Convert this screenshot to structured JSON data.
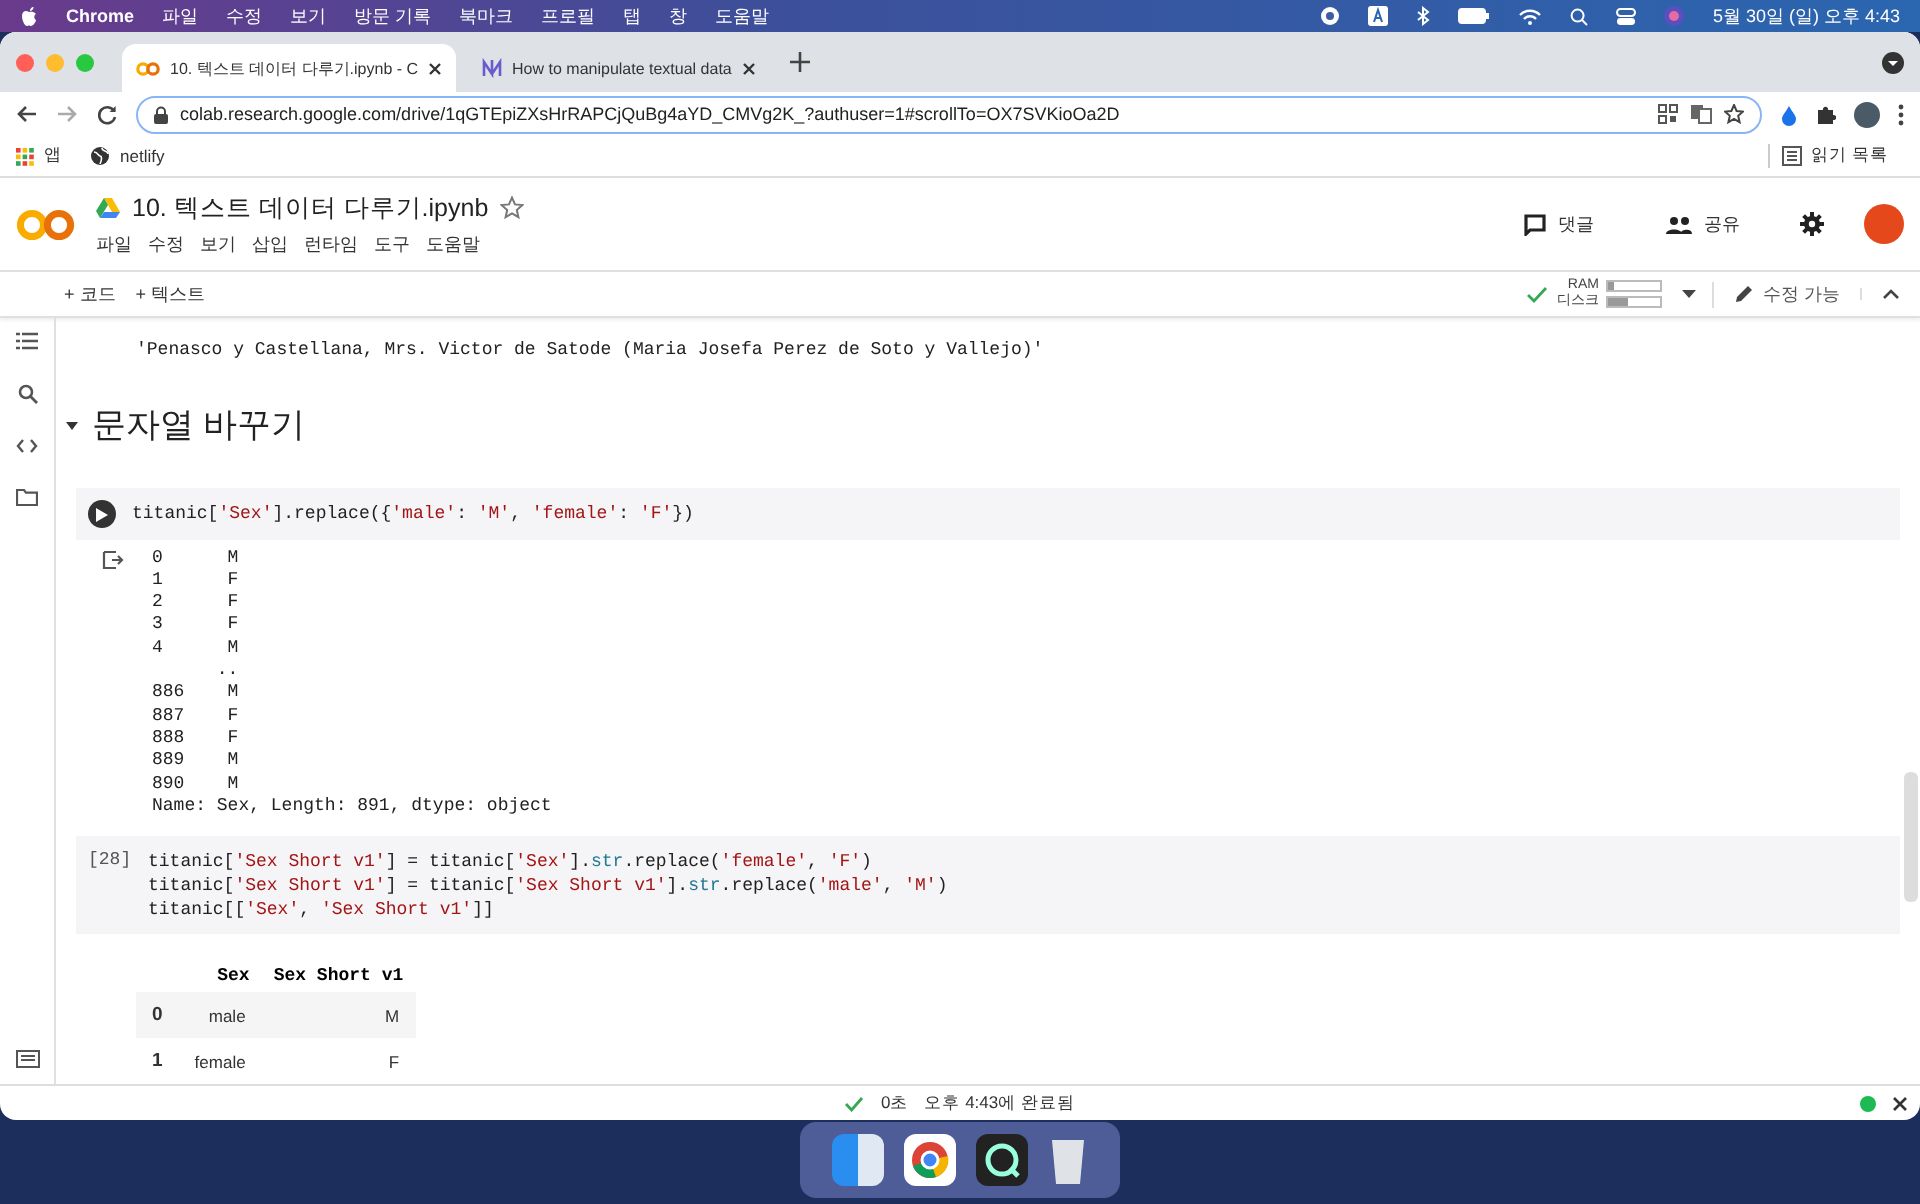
{
  "menubar": {
    "app": "Chrome",
    "menus": [
      "파일",
      "수정",
      "보기",
      "방문 기록",
      "북마크",
      "프로필",
      "탭",
      "창",
      "도움말"
    ],
    "clock": "5월 30일 (일) 오후 4:43"
  },
  "tabs": [
    {
      "title": "10. 텍스트 데이터 다루기.ipynb - C",
      "selected": true
    },
    {
      "title": "How to manipulate textual data",
      "selected": false
    }
  ],
  "address": {
    "url": "colab.research.google.com/drive/1qGTEpiZXsHrRAPCjQuBg4aYD_CMVg2K_?authuser=1#scrollTo=OX7SVKioOa2D"
  },
  "bookmarks": [
    {
      "kind": "apps",
      "label": "앱"
    },
    {
      "kind": "site",
      "label": "netlify"
    }
  ],
  "reading_list": "읽기 목록",
  "notebook": {
    "title": "10. 텍스트 데이터 다루기.ipynb",
    "menus": [
      "파일",
      "수정",
      "보기",
      "삽입",
      "런타임",
      "도구",
      "도움말"
    ],
    "comment": "댓글",
    "share": "공유"
  },
  "toolbar": {
    "add_code": "+ 코드",
    "add_text": "+ 텍스트",
    "resources": [
      {
        "label": "RAM",
        "level": 0.08
      },
      {
        "label": "디스크",
        "level": 0.38
      }
    ],
    "edit_mode": "수정 가능"
  },
  "cells": [
    {
      "kind": "output",
      "lines": [
        "'Penasco y Castellana, Mrs. Victor de Satode (Maria Josefa Perez de Soto y Vallejo)'"
      ]
    },
    {
      "kind": "heading",
      "text": "문자열 바꾸기",
      "expanded": true
    },
    {
      "kind": "code",
      "lines": [
        [
          {
            "kind": "plain",
            "text": "titanic["
          },
          {
            "kind": "string",
            "text": "'Sex'"
          },
          {
            "kind": "plain",
            "text": "].replace({"
          },
          {
            "kind": "string",
            "text": "'male'"
          },
          {
            "kind": "plain",
            "text": ": "
          },
          {
            "kind": "string",
            "text": "'M'"
          },
          {
            "kind": "plain",
            "text": ", "
          },
          {
            "kind": "string",
            "text": "'female'"
          },
          {
            "kind": "plain",
            "text": ": "
          },
          {
            "kind": "string",
            "text": "'F'"
          },
          {
            "kind": "plain",
            "text": "})"
          }
        ]
      ]
    },
    {
      "kind": "output",
      "lines": [
        "0      M",
        "1      F",
        "2      F",
        "3      F",
        "4      M",
        "      ..",
        "886    M",
        "887    F",
        "888    F",
        "889    M",
        "890    M",
        "Name: Sex, Length: 891, dtype: object"
      ]
    },
    {
      "kind": "code",
      "execution_count": "[28]",
      "lines": [
        [
          {
            "kind": "plain",
            "text": "titanic["
          },
          {
            "kind": "string",
            "text": "'Sex Short v1'"
          },
          {
            "kind": "plain",
            "text": "] = titanic["
          },
          {
            "kind": "string",
            "text": "'Sex'"
          },
          {
            "kind": "plain",
            "text": "]."
          },
          {
            "kind": "attr",
            "text": "str"
          },
          {
            "kind": "plain",
            "text": ".replace("
          },
          {
            "kind": "string",
            "text": "'female'"
          },
          {
            "kind": "plain",
            "text": ", "
          },
          {
            "kind": "string",
            "text": "'F'"
          },
          {
            "kind": "plain",
            "text": ")"
          }
        ],
        [
          {
            "kind": "plain",
            "text": "titanic["
          },
          {
            "kind": "string",
            "text": "'Sex Short v1'"
          },
          {
            "kind": "plain",
            "text": "] = titanic["
          },
          {
            "kind": "string",
            "text": "'Sex Short v1'"
          },
          {
            "kind": "plain",
            "text": "]."
          },
          {
            "kind": "attr",
            "text": "str"
          },
          {
            "kind": "plain",
            "text": ".replace("
          },
          {
            "kind": "string",
            "text": "'male'"
          },
          {
            "kind": "plain",
            "text": ", "
          },
          {
            "kind": "string",
            "text": "'M'"
          },
          {
            "kind": "plain",
            "text": ")"
          }
        ],
        [
          {
            "kind": "plain",
            "text": "titanic[["
          },
          {
            "kind": "string",
            "text": "'Sex'"
          },
          {
            "kind": "plain",
            "text": ", "
          },
          {
            "kind": "string",
            "text": "'Sex Short v1'"
          },
          {
            "kind": "plain",
            "text": "]]"
          }
        ]
      ]
    },
    {
      "kind": "table",
      "columns": [
        "Sex",
        "Sex Short v1"
      ],
      "rows": [
        {
          "index": "0",
          "cells": [
            "male",
            "M"
          ]
        },
        {
          "index": "1",
          "cells": [
            "female",
            "F"
          ]
        }
      ]
    }
  ],
  "status": {
    "duration": "0초",
    "completed": "오후 4:43에 완료됨"
  }
}
